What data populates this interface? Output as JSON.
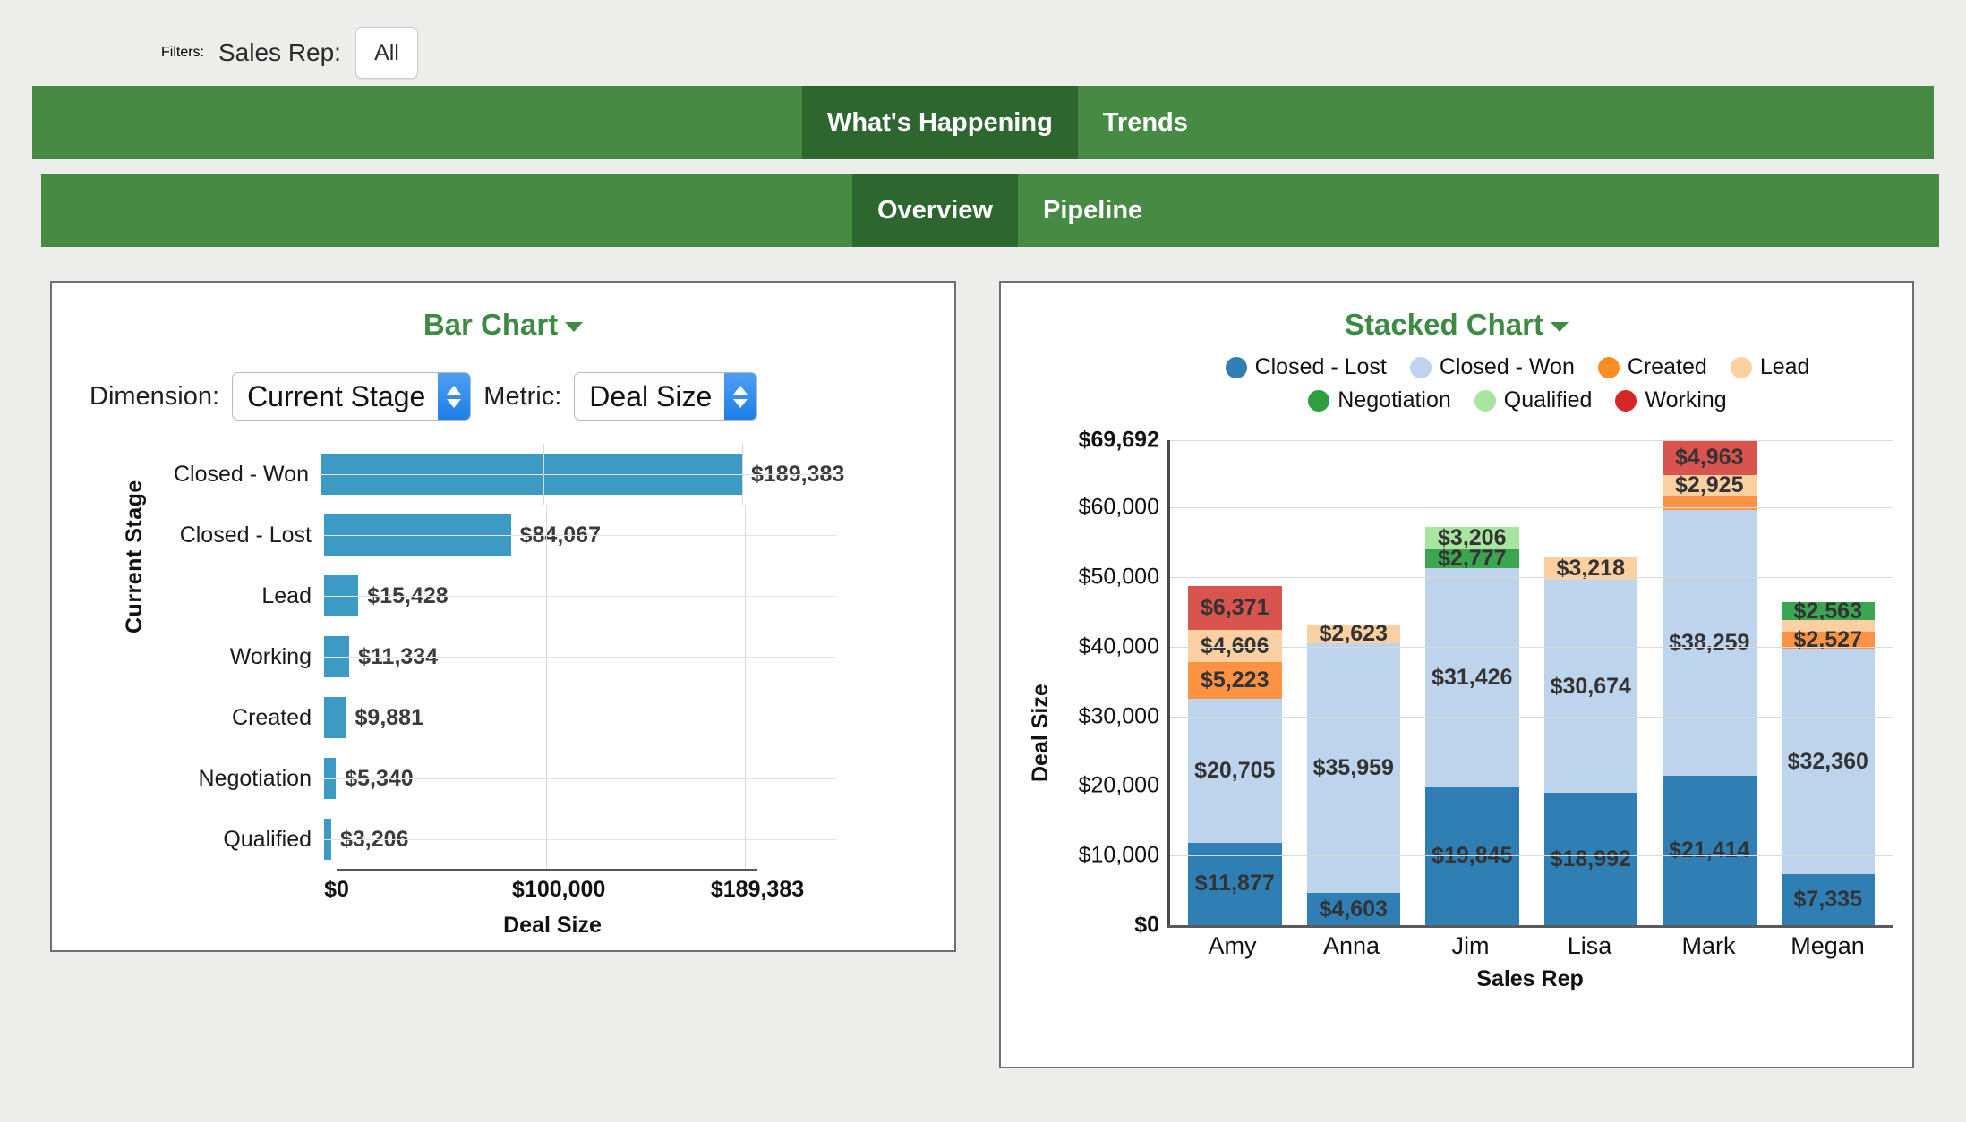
{
  "filters": {
    "label": "Filters:",
    "sales_rep_label": "Sales Rep:",
    "sales_rep_value": "All"
  },
  "tabs_primary": [
    {
      "label": "What's Happening",
      "active": true
    },
    {
      "label": "Trends",
      "active": false
    }
  ],
  "tabs_secondary": [
    {
      "label": "Overview",
      "active": true
    },
    {
      "label": "Pipeline",
      "active": false
    }
  ],
  "theme": {
    "tab_bar_green": "#468a44",
    "tab_active_green": "#2e6630",
    "title_green": "#3d8b43",
    "page_bg": "#edeeec",
    "bar_blue": "#3d9ac4"
  },
  "left_panel": {
    "title": "Bar Chart",
    "dimension_label": "Dimension:",
    "dimension_value": "Current Stage",
    "metric_label": "Metric:",
    "metric_value": "Deal Size"
  },
  "right_panel": {
    "title": "Stacked Chart"
  },
  "chart_data": [
    {
      "type": "bar",
      "orientation": "horizontal",
      "title": "Bar Chart",
      "xlabel": "Deal Size",
      "ylabel": "Current Stage",
      "xlim": [
        0,
        189383
      ],
      "xticks": [
        "$0",
        "$100,000",
        "$189,383"
      ],
      "xtick_values": [
        0,
        100000,
        189383
      ],
      "grid": true,
      "color": "#3d9ac4",
      "categories": [
        "Closed - Won",
        "Closed - Lost",
        "Lead",
        "Working",
        "Created",
        "Negotiation",
        "Qualified"
      ],
      "values": [
        189383,
        84067,
        15428,
        11334,
        9881,
        5340,
        3206
      ],
      "labels": [
        "$189,383",
        "$84,067",
        "$15,428",
        "$11,334",
        "$9,881",
        "$5,340",
        "$3,206"
      ]
    },
    {
      "type": "bar",
      "subtype": "stacked",
      "title": "Stacked Chart",
      "xlabel": "Sales Rep",
      "ylabel": "Deal Size",
      "ylim": [
        0,
        69692
      ],
      "yticks": [
        "$0",
        "$10,000",
        "$20,000",
        "$30,000",
        "$40,000",
        "$50,000",
        "$60,000",
        "$69,692"
      ],
      "ytick_values": [
        0,
        10000,
        20000,
        30000,
        40000,
        50000,
        60000,
        69692
      ],
      "grid": true,
      "legend_position": "top",
      "categories": [
        "Amy",
        "Anna",
        "Jim",
        "Lisa",
        "Mark",
        "Megan"
      ],
      "series": [
        {
          "name": "Closed - Lost",
          "color": "#2f7fb5",
          "values": [
            11877,
            4603,
            19845,
            18992,
            21414,
            7335
          ],
          "labels": [
            "$11,877",
            "$4,603",
            "$19,845",
            "$18,992",
            "$21,414",
            "$7,335"
          ]
        },
        {
          "name": "Closed - Won",
          "color": "#bed4ec",
          "values": [
            20705,
            35959,
            31426,
            30674,
            38259,
            32360
          ],
          "labels": [
            "$20,705",
            "$35,959",
            "$31,426",
            "$30,674",
            "$38,259",
            "$32,360"
          ]
        },
        {
          "name": "Created",
          "color": "#fd9343",
          "values": [
            5223,
            0,
            0,
            0,
            2100,
            2527
          ],
          "labels": [
            "$5,223",
            "",
            "",
            "",
            "",
            "$2,527"
          ]
        },
        {
          "name": "Lead",
          "color": "#fdd0a2",
          "values": [
            4606,
            2623,
            0,
            3218,
            2925,
            1600
          ],
          "labels": [
            "$4,606",
            "$2,623",
            "",
            "$3,218",
            "$2,925",
            ""
          ]
        },
        {
          "name": "Negotiation",
          "color": "#3ba551",
          "values": [
            0,
            0,
            2777,
            0,
            0,
            2563
          ],
          "labels": [
            "",
            "",
            "$2,777",
            "",
            "",
            "$2,563"
          ]
        },
        {
          "name": "Qualified",
          "color": "#a8e6a0",
          "values": [
            0,
            0,
            3206,
            0,
            0,
            0
          ],
          "labels": [
            "",
            "",
            "$3,206",
            "",
            "",
            ""
          ]
        },
        {
          "name": "Working",
          "color": "#d9534f",
          "values": [
            6371,
            0,
            0,
            0,
            4963,
            0
          ],
          "labels": [
            "$6,371",
            "",
            "",
            "",
            "$4,963",
            ""
          ]
        }
      ]
    }
  ],
  "legend": [
    {
      "label": "Closed - Lost",
      "color": "#2f7fb5"
    },
    {
      "label": "Closed - Won",
      "color": "#bed4ec"
    },
    {
      "label": "Created",
      "color": "#f98e24"
    },
    {
      "label": "Lead",
      "color": "#fdd0a2"
    },
    {
      "label": "Negotiation",
      "color": "#2e9e3f"
    },
    {
      "label": "Qualified",
      "color": "#a8e6a0"
    },
    {
      "label": "Working",
      "color": "#d62728"
    }
  ]
}
